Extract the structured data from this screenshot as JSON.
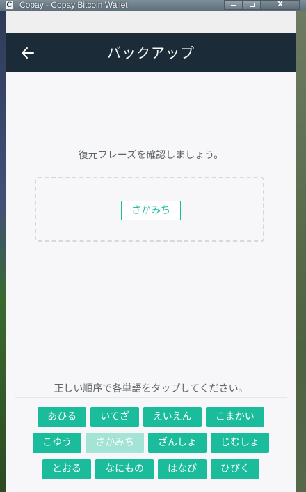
{
  "window": {
    "title": "Copay - Copay Bitcoin Wallet",
    "icon_letter": "C",
    "close_glyph": "X"
  },
  "header": {
    "title": "バックアップ"
  },
  "confirm": {
    "prompt": "復元フレーズを確認しましょう。",
    "selected_words": [
      "さかみち"
    ]
  },
  "word_bank": {
    "instructions": "正しい順序で各単語をタップしてください。",
    "rows": [
      [
        {
          "label": "あひる",
          "used": false
        },
        {
          "label": "いてざ",
          "used": false
        },
        {
          "label": "えいえん",
          "used": false
        },
        {
          "label": "こまかい",
          "used": false
        }
      ],
      [
        {
          "label": "こゆう",
          "used": false
        },
        {
          "label": "さかみち",
          "used": true
        },
        {
          "label": "ざんしょ",
          "used": false
        },
        {
          "label": "じむしょ",
          "used": false
        }
      ],
      [
        {
          "label": "とおる",
          "used": false
        },
        {
          "label": "なにもの",
          "used": false
        },
        {
          "label": "はなび",
          "used": false
        },
        {
          "label": "ひびく",
          "used": false
        }
      ]
    ]
  },
  "colors": {
    "accent": "#1abc9c",
    "accent_used": "#a4e4d6",
    "header_bg": "#1b2b38"
  }
}
